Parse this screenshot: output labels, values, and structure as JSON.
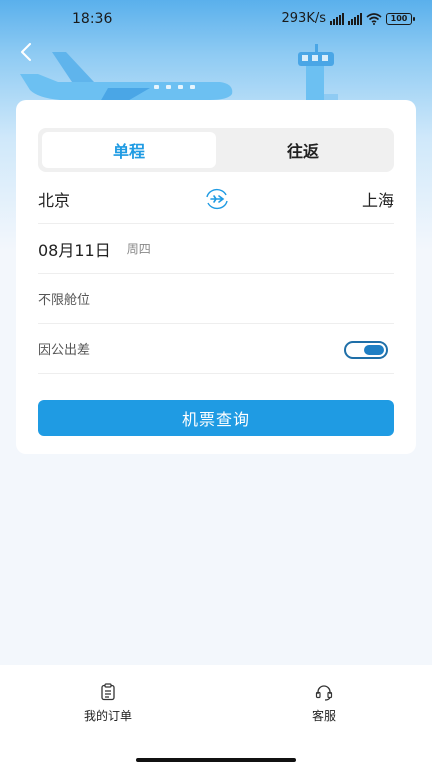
{
  "status": {
    "time": "18:36",
    "network_speed": "293K/s",
    "battery": "100"
  },
  "header": {
    "back_icon": "chevron-left-icon"
  },
  "trip_tabs": [
    {
      "label": "单程",
      "active": true
    },
    {
      "label": "往返",
      "active": false
    }
  ],
  "route": {
    "from": "北京",
    "to": "上海",
    "swap_icon": "plane-swap-icon"
  },
  "date": {
    "value": "08月11日",
    "weekday": "周四"
  },
  "cabin": {
    "label": "不限舱位"
  },
  "business_trip": {
    "label": "因公出差",
    "enabled": true
  },
  "search_button": "机票查询",
  "bottom_nav": [
    {
      "label": "我的订单",
      "icon": "clipboard-icon"
    },
    {
      "label": "客服",
      "icon": "headset-icon"
    }
  ],
  "colors": {
    "accent": "#1f9be3",
    "hero_top": "#5ab0ec"
  }
}
